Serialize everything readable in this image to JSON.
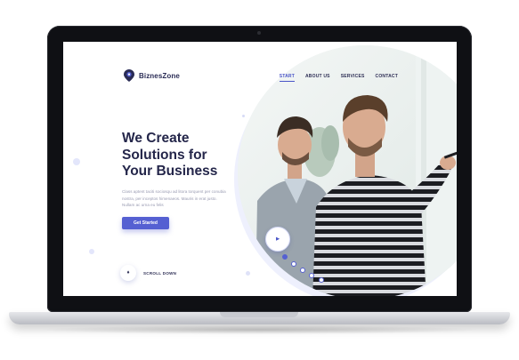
{
  "site": {
    "brand": "BiznesZone",
    "nav": [
      {
        "label": "START",
        "active": true
      },
      {
        "label": "ABOUT US",
        "active": false
      },
      {
        "label": "SERVICES",
        "active": false
      },
      {
        "label": "CONTACT",
        "active": false
      }
    ],
    "hero": {
      "title_lines": [
        "We Create",
        "Solutions for",
        "Your Business"
      ],
      "body": "Class aptent taciti sociosqu ad litora torquent per conubia nostra, per inceptos himenaeos. Mauris in erat justo. Nullam ac urna eu felis",
      "cta_label": "Get Started"
    },
    "play_label": "▶",
    "scroll_label": "SCROLL DOWN",
    "scroll_icon": "♦",
    "slider": {
      "count": 5,
      "active_index": 0
    }
  },
  "colors": {
    "accent": "#5560d2",
    "heading": "#24264a",
    "body_text": "#9a9cb2",
    "laptop_bezel": "#0f1014"
  },
  "icons": {
    "logo": "location-pin-logo-icon",
    "scroll": "diamond-icon",
    "play": "play-icon"
  }
}
